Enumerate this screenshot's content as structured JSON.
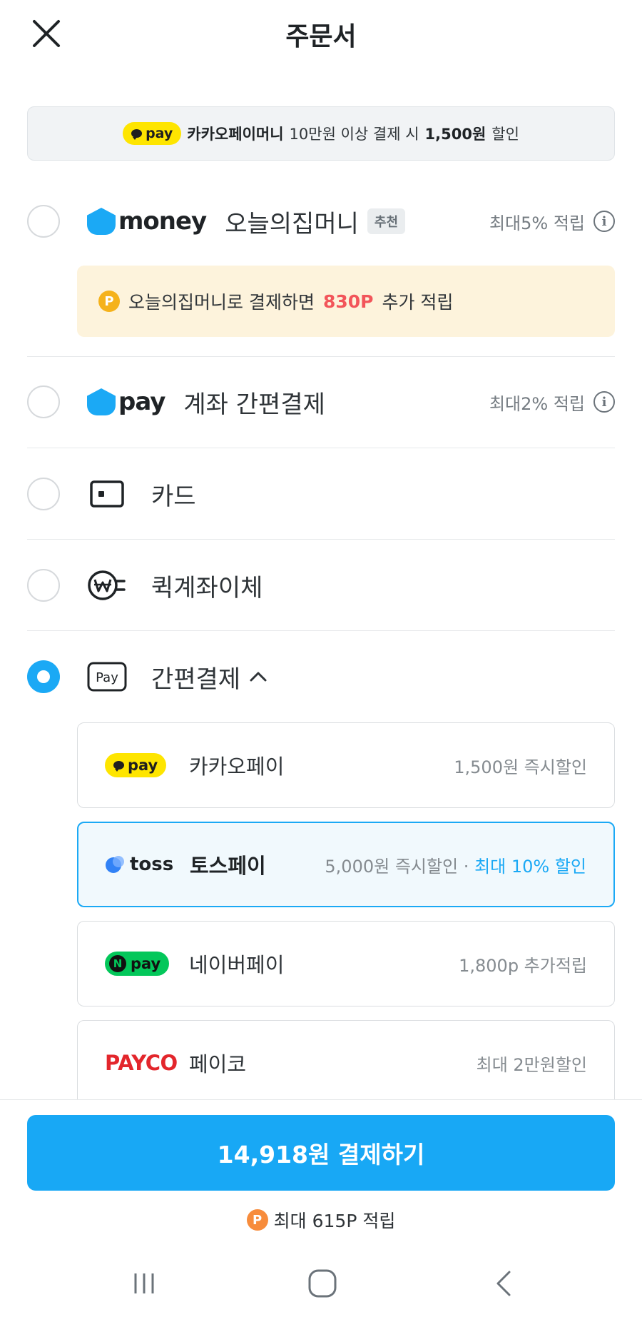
{
  "header": {
    "title": "주문서"
  },
  "banner": {
    "badge_label": "pay",
    "brand": "카카오페이머니",
    "text_mid": "10만원 이상 결제 시",
    "amount": "1,500원",
    "text_end": "할인"
  },
  "methods": {
    "money": {
      "logo_text": "money",
      "label": "오늘의집머니",
      "badge": "추천",
      "reward": "최대5% 적립",
      "note_prefix": "오늘의집머니로 결제하면",
      "note_points": "830P",
      "note_suffix": "추가 적립"
    },
    "pay": {
      "logo_text": "pay",
      "label": "계좌 간편결제",
      "reward": "최대2% 적립"
    },
    "card": {
      "label": "카드"
    },
    "quick_transfer": {
      "label": "퀵계좌이체"
    },
    "easy_pay": {
      "label": "간편결제",
      "expand_icon": "chevron-up-icon",
      "selected": true,
      "options": [
        {
          "logo": "pay",
          "name": "카카오페이",
          "benefit": "1,500원 즉시할인"
        },
        {
          "logo": "toss",
          "name": "토스페이",
          "benefit": "5,000원 즉시할인",
          "sep": "·",
          "benefit_highlight": "최대 10% 할인",
          "selected": true
        },
        {
          "logo_n": "N",
          "logo": "pay",
          "name": "네이버페이",
          "benefit": "1,800p 추가적립"
        },
        {
          "logo": "PAYCO",
          "name": "페이코",
          "benefit": "최대 2만원할인"
        }
      ]
    }
  },
  "footer": {
    "pay_button": "14,918원 결제하기",
    "points": "최대 615P 적립",
    "point_icon": "P"
  },
  "colors": {
    "primary": "#1ba9f5",
    "kakao_yellow": "#fee500",
    "naver_green": "#03c75a",
    "payco_red": "#e3262c",
    "highlight_red": "#f2555a"
  }
}
